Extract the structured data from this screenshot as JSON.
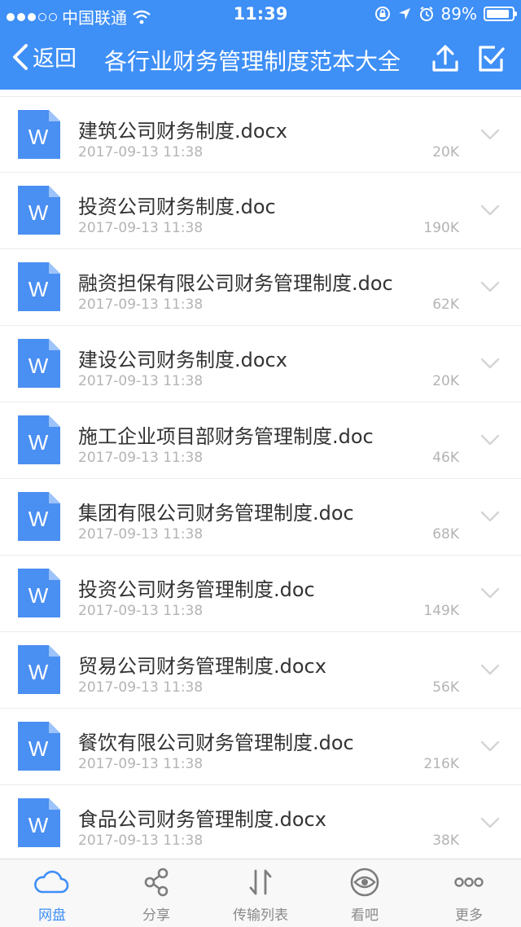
{
  "status_bar": {
    "carrier": "中国联通",
    "time": "11:39",
    "battery": "89%"
  },
  "nav": {
    "back_label": "返回",
    "title": "各行业财务管理制度范本大全"
  },
  "files": [
    {
      "name": "建筑公司财务制度.docx",
      "date": "2017-09-13 11:38",
      "size": "20K"
    },
    {
      "name": "投资公司财务制度.doc",
      "date": "2017-09-13 11:38",
      "size": "190K"
    },
    {
      "name": "融资担保有限公司财务管理制度.doc",
      "date": "2017-09-13 11:38",
      "size": "62K"
    },
    {
      "name": "建设公司财务制度.docx",
      "date": "2017-09-13 11:38",
      "size": "20K"
    },
    {
      "name": "施工企业项目部财务管理制度.doc",
      "date": "2017-09-13 11:38",
      "size": "46K"
    },
    {
      "name": "集团有限公司财务管理制度.doc",
      "date": "2017-09-13 11:38",
      "size": "68K"
    },
    {
      "name": "投资公司财务管理制度.doc",
      "date": "2017-09-13 11:38",
      "size": "149K"
    },
    {
      "name": "贸易公司财务管理制度.docx",
      "date": "2017-09-13 11:38",
      "size": "56K"
    },
    {
      "name": "餐饮有限公司财务管理制度.doc",
      "date": "2017-09-13 11:38",
      "size": "216K"
    },
    {
      "name": "食品公司财务管理制度.docx",
      "date": "2017-09-13 11:38",
      "size": "38K"
    }
  ],
  "file_icon_letter": "W",
  "tabs": [
    {
      "label": "网盘",
      "icon": "cloud-icon",
      "active": true
    },
    {
      "label": "分享",
      "icon": "share-icon",
      "active": false
    },
    {
      "label": "传输列表",
      "icon": "transfer-icon",
      "active": false
    },
    {
      "label": "看吧",
      "icon": "eye-icon",
      "active": false
    },
    {
      "label": "更多",
      "icon": "more-icon",
      "active": false
    }
  ],
  "colors": {
    "brand": "#3e8ff6",
    "file_icon": "#4a8ff2"
  }
}
